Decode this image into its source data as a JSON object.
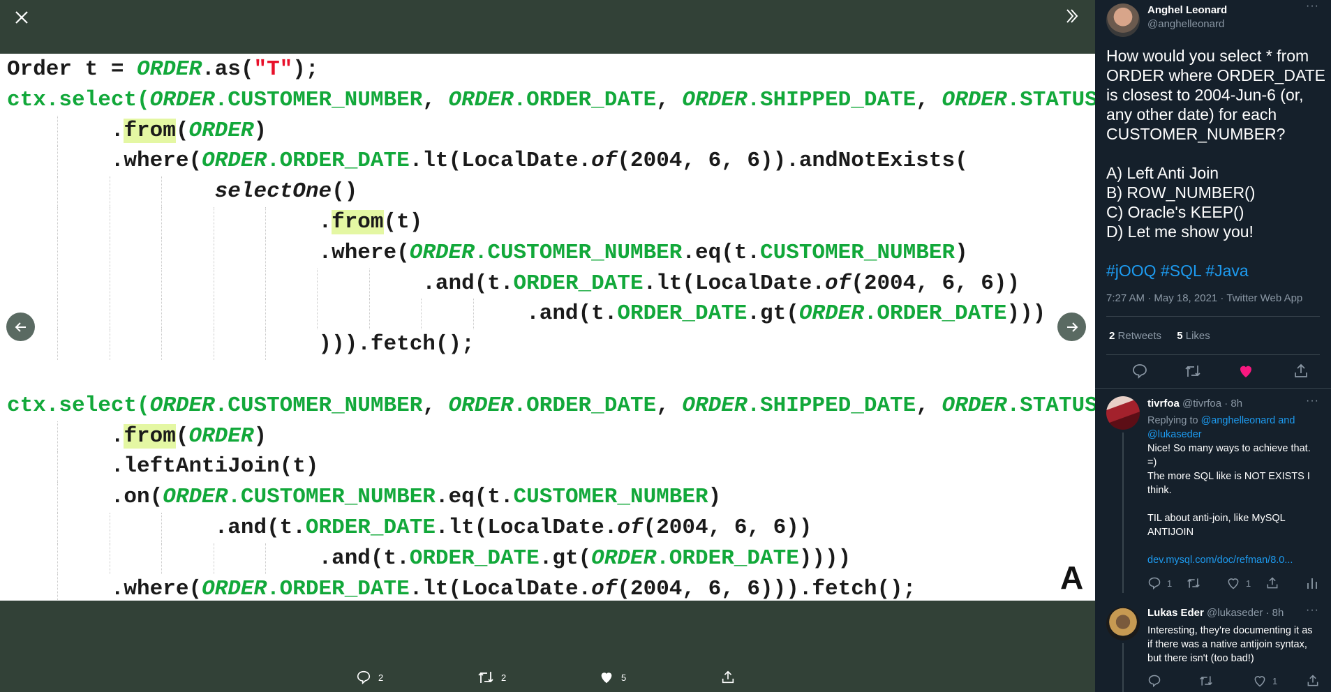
{
  "viewer": {
    "close_icon": "close-icon",
    "expand_icon": "double-chevron-right-icon",
    "prev_icon": "arrow-left-icon",
    "next_icon": "arrow-right-icon",
    "corner_letter": "A",
    "bottom_bar": {
      "replies": "2",
      "retweets": "2",
      "likes": "5"
    },
    "colors": {
      "backdrop": "#324137",
      "code_green": "#12a83a",
      "string_red": "#e8102a",
      "highlight": "#e4f7a3"
    }
  },
  "code": {
    "lines": [
      {
        "indent": 0,
        "tokens": [
          {
            "t": "k",
            "v": "Order t = "
          },
          {
            "t": "gi",
            "v": "ORDER"
          },
          {
            "t": "k",
            "v": ".as("
          },
          {
            "t": "s",
            "v": "\"T\""
          },
          {
            "t": "k",
            "v": ");"
          }
        ]
      },
      {
        "indent": 0,
        "tokens": [
          {
            "t": "g",
            "v": "ctx.select("
          },
          {
            "t": "gi",
            "v": "ORDER"
          },
          {
            "t": "g",
            "v": ".CUSTOMER_NUMBER"
          },
          {
            "t": "k",
            "v": ", "
          },
          {
            "t": "gi",
            "v": "ORDER"
          },
          {
            "t": "g",
            "v": ".ORDER_DATE"
          },
          {
            "t": "k",
            "v": ", "
          },
          {
            "t": "gi",
            "v": "ORDER"
          },
          {
            "t": "g",
            "v": ".SHIPPED_DATE"
          },
          {
            "t": "k",
            "v": ", "
          },
          {
            "t": "gi",
            "v": "ORDER"
          },
          {
            "t": "g",
            "v": ".STATUS"
          },
          {
            "t": "k",
            "v": ")"
          }
        ]
      },
      {
        "indent": 8,
        "tokens": [
          {
            "t": "k",
            "v": "."
          },
          {
            "t": "h",
            "v": "from"
          },
          {
            "t": "k",
            "v": "("
          },
          {
            "t": "gi",
            "v": "ORDER"
          },
          {
            "t": "k",
            "v": ")"
          }
        ]
      },
      {
        "indent": 8,
        "tokens": [
          {
            "t": "k",
            "v": ".where("
          },
          {
            "t": "gi",
            "v": "ORDER"
          },
          {
            "t": "g",
            "v": ".ORDER_DATE"
          },
          {
            "t": "k",
            "v": ".lt(LocalDate."
          },
          {
            "t": "i",
            "v": "of"
          },
          {
            "t": "k",
            "v": "(2004, 6, 6)).andNotExists("
          }
        ]
      },
      {
        "indent": 16,
        "tokens": [
          {
            "t": "i",
            "v": "selectOne"
          },
          {
            "t": "k",
            "v": "()"
          }
        ]
      },
      {
        "indent": 24,
        "tokens": [
          {
            "t": "k",
            "v": "."
          },
          {
            "t": "h",
            "v": "from"
          },
          {
            "t": "k",
            "v": "(t)"
          }
        ]
      },
      {
        "indent": 24,
        "tokens": [
          {
            "t": "k",
            "v": ".where("
          },
          {
            "t": "gi",
            "v": "ORDER"
          },
          {
            "t": "g",
            "v": ".CUSTOMER_NUMBER"
          },
          {
            "t": "k",
            "v": ".eq(t."
          },
          {
            "t": "g",
            "v": "CUSTOMER_NUMBER"
          },
          {
            "t": "k",
            "v": ")"
          }
        ]
      },
      {
        "indent": 32,
        "tokens": [
          {
            "t": "k",
            "v": ".and(t."
          },
          {
            "t": "g",
            "v": "ORDER_DATE"
          },
          {
            "t": "k",
            "v": ".lt(LocalDate."
          },
          {
            "t": "i",
            "v": "of"
          },
          {
            "t": "k",
            "v": "(2004, 6, 6))"
          }
        ]
      },
      {
        "indent": 40,
        "tokens": [
          {
            "t": "k",
            "v": ".and(t."
          },
          {
            "t": "g",
            "v": "ORDER_DATE"
          },
          {
            "t": "k",
            "v": ".gt("
          },
          {
            "t": "gi",
            "v": "ORDER"
          },
          {
            "t": "g",
            "v": ".ORDER_DATE"
          },
          {
            "t": "k",
            "v": ")))"
          }
        ]
      },
      {
        "indent": 24,
        "tokens": [
          {
            "t": "k",
            "v": "))).fetch();"
          }
        ]
      },
      {
        "indent": 0,
        "tokens": []
      },
      {
        "indent": 0,
        "tokens": [
          {
            "t": "g",
            "v": "ctx.select("
          },
          {
            "t": "gi",
            "v": "ORDER"
          },
          {
            "t": "g",
            "v": ".CUSTOMER_NUMBER"
          },
          {
            "t": "k",
            "v": ", "
          },
          {
            "t": "gi",
            "v": "ORDER"
          },
          {
            "t": "g",
            "v": ".ORDER_DATE"
          },
          {
            "t": "k",
            "v": ", "
          },
          {
            "t": "gi",
            "v": "ORDER"
          },
          {
            "t": "g",
            "v": ".SHIPPED_DATE"
          },
          {
            "t": "k",
            "v": ", "
          },
          {
            "t": "gi",
            "v": "ORDER"
          },
          {
            "t": "g",
            "v": ".STATUS"
          },
          {
            "t": "k",
            "v": ")"
          }
        ]
      },
      {
        "indent": 8,
        "tokens": [
          {
            "t": "k",
            "v": "."
          },
          {
            "t": "h",
            "v": "from"
          },
          {
            "t": "k",
            "v": "("
          },
          {
            "t": "gi",
            "v": "ORDER"
          },
          {
            "t": "k",
            "v": ")"
          }
        ]
      },
      {
        "indent": 8,
        "tokens": [
          {
            "t": "k",
            "v": ".leftAntiJoin(t)"
          }
        ]
      },
      {
        "indent": 8,
        "tokens": [
          {
            "t": "k",
            "v": ".on("
          },
          {
            "t": "gi",
            "v": "ORDER"
          },
          {
            "t": "g",
            "v": ".CUSTOMER_NUMBER"
          },
          {
            "t": "k",
            "v": ".eq(t."
          },
          {
            "t": "g",
            "v": "CUSTOMER_NUMBER"
          },
          {
            "t": "k",
            "v": ")"
          }
        ]
      },
      {
        "indent": 16,
        "tokens": [
          {
            "t": "k",
            "v": ".and(t."
          },
          {
            "t": "g",
            "v": "ORDER_DATE"
          },
          {
            "t": "k",
            "v": ".lt(LocalDate."
          },
          {
            "t": "i",
            "v": "of"
          },
          {
            "t": "k",
            "v": "(2004, 6, 6))"
          }
        ]
      },
      {
        "indent": 24,
        "tokens": [
          {
            "t": "k",
            "v": ".and(t."
          },
          {
            "t": "g",
            "v": "ORDER_DATE"
          },
          {
            "t": "k",
            "v": ".gt("
          },
          {
            "t": "gi",
            "v": "ORDER"
          },
          {
            "t": "g",
            "v": ".ORDER_DATE"
          },
          {
            "t": "k",
            "v": "))))"
          }
        ]
      },
      {
        "indent": 8,
        "tokens": [
          {
            "t": "k",
            "v": ".where("
          },
          {
            "t": "gi",
            "v": "ORDER"
          },
          {
            "t": "g",
            "v": ".ORDER_DATE"
          },
          {
            "t": "k",
            "v": ".lt(LocalDate."
          },
          {
            "t": "i",
            "v": "of"
          },
          {
            "t": "k",
            "v": "(2004, 6, 6))).fetch();"
          }
        ]
      }
    ]
  },
  "tweet": {
    "author_name": "Anghel Leonard",
    "author_handle": "@anghelleonard",
    "text_lines": [
      "How would you select * from",
      "ORDER where ORDER_DATE",
      "is closest to 2004-Jun-6 (or,",
      "any other date) for each",
      "CUSTOMER_NUMBER?"
    ],
    "options": [
      "A) Left Anti Join",
      "B) ROW_NUMBER()",
      "C) Oracle's KEEP()",
      "D) Let me show you!"
    ],
    "hashtags": "#jOOQ #SQL #Java",
    "meta": "7:27 AM · May 18, 2021 · Twitter Web App",
    "retweets_count": "2",
    "retweets_label": "Retweets",
    "likes_count": "5",
    "likes_label": "Likes",
    "like_color": "#f91880"
  },
  "replies": [
    {
      "name": "tivrfoa",
      "handle_time": "@tivrfoa · 8h",
      "replying_prefix": "Replying to",
      "replying_to_1": "@anghelleonard and",
      "replying_to_2": "@lukaseder",
      "text_lines": [
        "Nice! So many ways to achieve that.",
        "=)",
        "The more SQL like is NOT EXISTS I",
        "think.",
        "",
        "TIL about anti-join, like MySQL",
        "ANTIJOIN",
        ""
      ],
      "link": "dev.mysql.com/doc/refman/8.0...",
      "reply_count": "1",
      "like_count": "1"
    },
    {
      "name": "Lukas Eder",
      "handle_time": "@lukaseder · 8h",
      "text_lines": [
        "Interesting, they're documenting it as",
        "if there was a native antijoin syntax,",
        "but there isn't (too bad!)"
      ],
      "like_count": "1"
    }
  ]
}
